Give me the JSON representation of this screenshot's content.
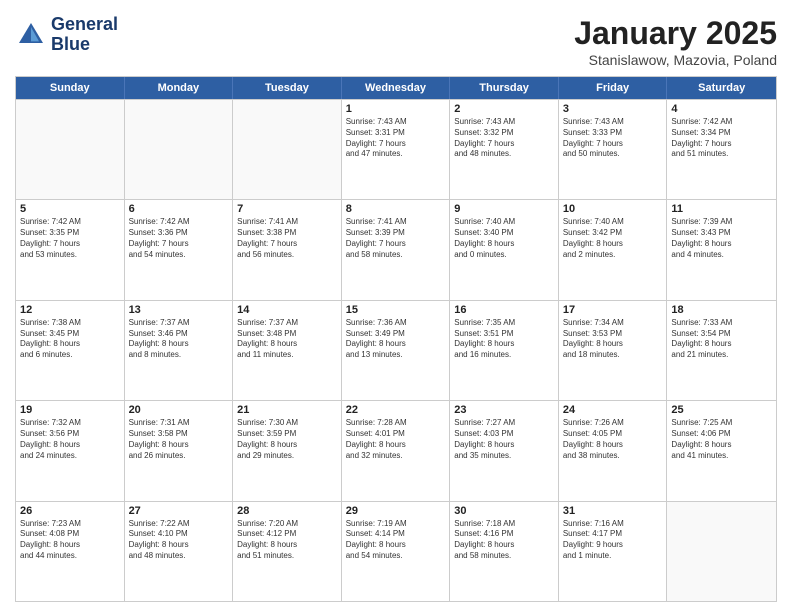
{
  "header": {
    "logo_line1": "General",
    "logo_line2": "Blue",
    "month": "January 2025",
    "location": "Stanislawow, Mazovia, Poland"
  },
  "days_of_week": [
    "Sunday",
    "Monday",
    "Tuesday",
    "Wednesday",
    "Thursday",
    "Friday",
    "Saturday"
  ],
  "weeks": [
    [
      {
        "day": "",
        "content": ""
      },
      {
        "day": "",
        "content": ""
      },
      {
        "day": "",
        "content": ""
      },
      {
        "day": "1",
        "content": "Sunrise: 7:43 AM\nSunset: 3:31 PM\nDaylight: 7 hours\nand 47 minutes."
      },
      {
        "day": "2",
        "content": "Sunrise: 7:43 AM\nSunset: 3:32 PM\nDaylight: 7 hours\nand 48 minutes."
      },
      {
        "day": "3",
        "content": "Sunrise: 7:43 AM\nSunset: 3:33 PM\nDaylight: 7 hours\nand 50 minutes."
      },
      {
        "day": "4",
        "content": "Sunrise: 7:42 AM\nSunset: 3:34 PM\nDaylight: 7 hours\nand 51 minutes."
      }
    ],
    [
      {
        "day": "5",
        "content": "Sunrise: 7:42 AM\nSunset: 3:35 PM\nDaylight: 7 hours\nand 53 minutes."
      },
      {
        "day": "6",
        "content": "Sunrise: 7:42 AM\nSunset: 3:36 PM\nDaylight: 7 hours\nand 54 minutes."
      },
      {
        "day": "7",
        "content": "Sunrise: 7:41 AM\nSunset: 3:38 PM\nDaylight: 7 hours\nand 56 minutes."
      },
      {
        "day": "8",
        "content": "Sunrise: 7:41 AM\nSunset: 3:39 PM\nDaylight: 7 hours\nand 58 minutes."
      },
      {
        "day": "9",
        "content": "Sunrise: 7:40 AM\nSunset: 3:40 PM\nDaylight: 8 hours\nand 0 minutes."
      },
      {
        "day": "10",
        "content": "Sunrise: 7:40 AM\nSunset: 3:42 PM\nDaylight: 8 hours\nand 2 minutes."
      },
      {
        "day": "11",
        "content": "Sunrise: 7:39 AM\nSunset: 3:43 PM\nDaylight: 8 hours\nand 4 minutes."
      }
    ],
    [
      {
        "day": "12",
        "content": "Sunrise: 7:38 AM\nSunset: 3:45 PM\nDaylight: 8 hours\nand 6 minutes."
      },
      {
        "day": "13",
        "content": "Sunrise: 7:37 AM\nSunset: 3:46 PM\nDaylight: 8 hours\nand 8 minutes."
      },
      {
        "day": "14",
        "content": "Sunrise: 7:37 AM\nSunset: 3:48 PM\nDaylight: 8 hours\nand 11 minutes."
      },
      {
        "day": "15",
        "content": "Sunrise: 7:36 AM\nSunset: 3:49 PM\nDaylight: 8 hours\nand 13 minutes."
      },
      {
        "day": "16",
        "content": "Sunrise: 7:35 AM\nSunset: 3:51 PM\nDaylight: 8 hours\nand 16 minutes."
      },
      {
        "day": "17",
        "content": "Sunrise: 7:34 AM\nSunset: 3:53 PM\nDaylight: 8 hours\nand 18 minutes."
      },
      {
        "day": "18",
        "content": "Sunrise: 7:33 AM\nSunset: 3:54 PM\nDaylight: 8 hours\nand 21 minutes."
      }
    ],
    [
      {
        "day": "19",
        "content": "Sunrise: 7:32 AM\nSunset: 3:56 PM\nDaylight: 8 hours\nand 24 minutes."
      },
      {
        "day": "20",
        "content": "Sunrise: 7:31 AM\nSunset: 3:58 PM\nDaylight: 8 hours\nand 26 minutes."
      },
      {
        "day": "21",
        "content": "Sunrise: 7:30 AM\nSunset: 3:59 PM\nDaylight: 8 hours\nand 29 minutes."
      },
      {
        "day": "22",
        "content": "Sunrise: 7:28 AM\nSunset: 4:01 PM\nDaylight: 8 hours\nand 32 minutes."
      },
      {
        "day": "23",
        "content": "Sunrise: 7:27 AM\nSunset: 4:03 PM\nDaylight: 8 hours\nand 35 minutes."
      },
      {
        "day": "24",
        "content": "Sunrise: 7:26 AM\nSunset: 4:05 PM\nDaylight: 8 hours\nand 38 minutes."
      },
      {
        "day": "25",
        "content": "Sunrise: 7:25 AM\nSunset: 4:06 PM\nDaylight: 8 hours\nand 41 minutes."
      }
    ],
    [
      {
        "day": "26",
        "content": "Sunrise: 7:23 AM\nSunset: 4:08 PM\nDaylight: 8 hours\nand 44 minutes."
      },
      {
        "day": "27",
        "content": "Sunrise: 7:22 AM\nSunset: 4:10 PM\nDaylight: 8 hours\nand 48 minutes."
      },
      {
        "day": "28",
        "content": "Sunrise: 7:20 AM\nSunset: 4:12 PM\nDaylight: 8 hours\nand 51 minutes."
      },
      {
        "day": "29",
        "content": "Sunrise: 7:19 AM\nSunset: 4:14 PM\nDaylight: 8 hours\nand 54 minutes."
      },
      {
        "day": "30",
        "content": "Sunrise: 7:18 AM\nSunset: 4:16 PM\nDaylight: 8 hours\nand 58 minutes."
      },
      {
        "day": "31",
        "content": "Sunrise: 7:16 AM\nSunset: 4:17 PM\nDaylight: 9 hours\nand 1 minute."
      },
      {
        "day": "",
        "content": ""
      }
    ]
  ]
}
